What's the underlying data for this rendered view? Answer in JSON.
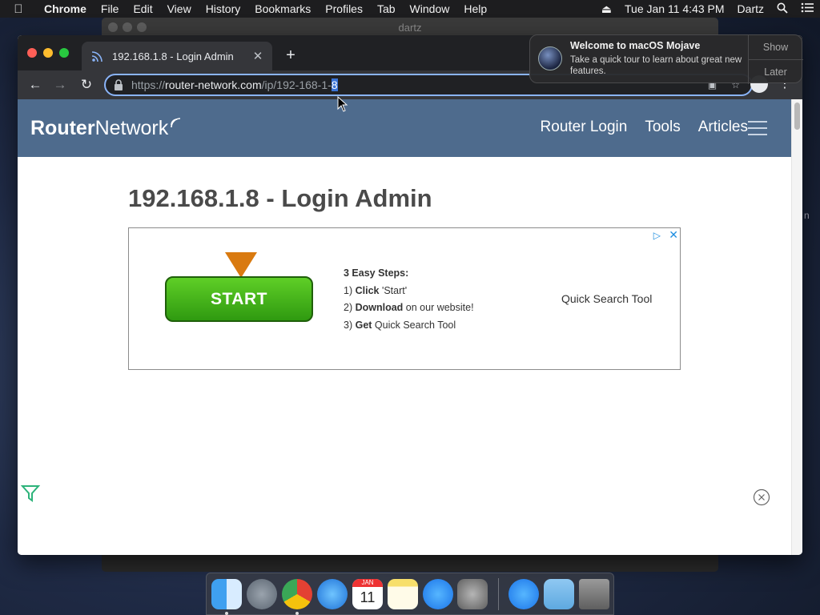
{
  "menubar": {
    "app_name": "Chrome",
    "items": [
      "File",
      "Edit",
      "View",
      "History",
      "Bookmarks",
      "Profiles",
      "Tab",
      "Window",
      "Help"
    ],
    "datetime": "Tue Jan 11  4:43 PM",
    "user": "Dartz"
  },
  "bg_window": {
    "title": "dartz"
  },
  "browser": {
    "tab_title": "192.168.1.8 - Login Admin",
    "url_scheme": "https://",
    "url_host": "router-network.com",
    "url_path": "/ip/192-168-1-",
    "url_selected": "8"
  },
  "site": {
    "logo_part1": "Router",
    "logo_part2": "Network",
    "nav": [
      "Router Login",
      "Tools",
      "Articles"
    ],
    "page_title": "192.168.1.8 - Login Admin",
    "brand_color": "#4e6b8d"
  },
  "ad": {
    "button_label": "START",
    "steps_heading": "3 Easy Steps:",
    "step1_prefix": "1) ",
    "step1_bold": "Click",
    "step1_rest": " 'Start'",
    "step2_prefix": "2) ",
    "step2_bold": "Download",
    "step2_rest": " on our website!",
    "step3_prefix": "3) ",
    "step3_bold": "Get",
    "step3_rest": " Quick Search Tool",
    "right_text": "Quick Search Tool"
  },
  "notification": {
    "title": "Welcome to macOS Mojave",
    "body": "Take a quick tour to learn about great new features.",
    "show_label": "Show",
    "later_label": "Later"
  },
  "dock": {
    "calendar_month": "JAN",
    "calendar_day": "11"
  }
}
